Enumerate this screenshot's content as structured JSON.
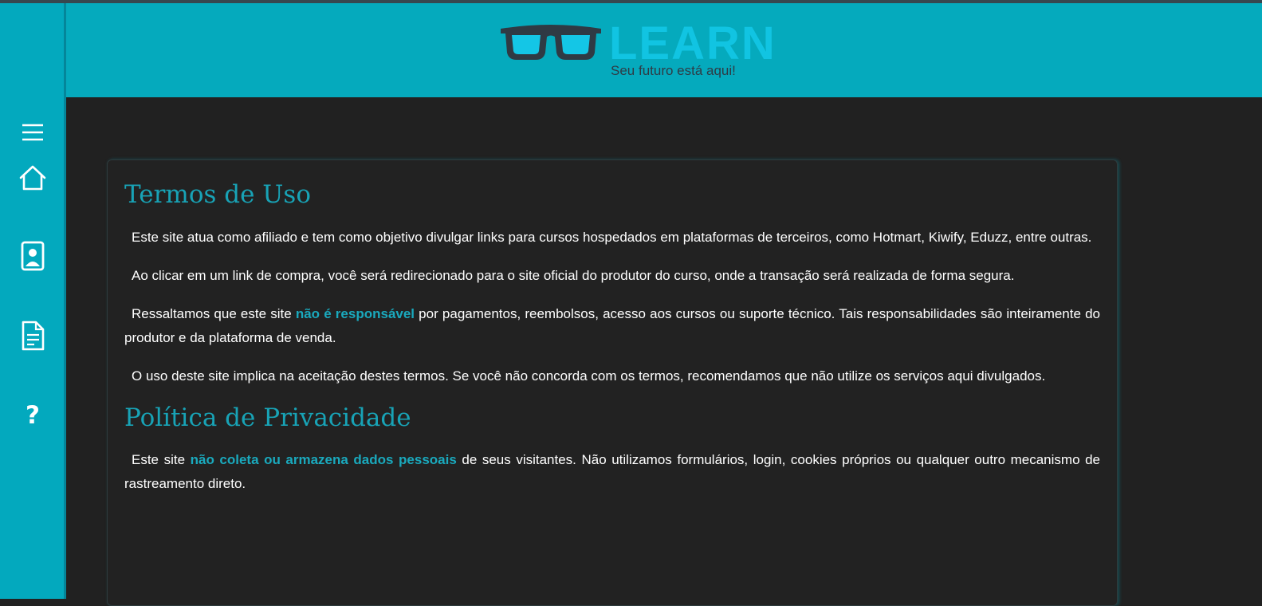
{
  "brand": {
    "name": "LEARN",
    "tagline": "Seu futuro está aqui!"
  },
  "colors": {
    "accent": "#03a9be",
    "heading": "#18a3b6",
    "highlight": "#1aa9bd",
    "background": "#212121",
    "logo_text": "#11c4e2"
  },
  "sidebar": {
    "items": [
      {
        "icon": "menu-icon"
      },
      {
        "icon": "home-icon"
      },
      {
        "icon": "contact-card-icon"
      },
      {
        "icon": "document-icon"
      },
      {
        "icon": "help-icon",
        "label": "?"
      }
    ]
  },
  "terms": {
    "title": "Termos de Uso",
    "p1": "Este site atua como afiliado e tem como objetivo divulgar links para cursos hospedados em plataformas de terceiros, como Hotmart, Kiwify, Eduzz, entre outras.",
    "p2": "Ao clicar em um link de compra, você será redirecionado para o site oficial do produtor do curso, onde a transação será realizada de forma segura.",
    "p3_before": "Ressaltamos que este site ",
    "p3_highlight": "não é responsável",
    "p3_after": " por pagamentos, reembolsos, acesso aos cursos ou suporte técnico. Tais responsabilidades são inteiramente do produtor e da plataforma de venda.",
    "p4": "O uso deste site implica na aceitação destes termos. Se você não concorda com os termos, recomendamos que não utilize os serviços aqui divulgados."
  },
  "privacy": {
    "title": "Política de Privacidade",
    "p1_before": "Este site ",
    "p1_highlight": "não coleta ou armazena dados pessoais",
    "p1_after": " de seus visitantes. Não utilizamos formulários, login, cookies próprios ou qualquer outro mecanismo de rastreamento direto."
  }
}
